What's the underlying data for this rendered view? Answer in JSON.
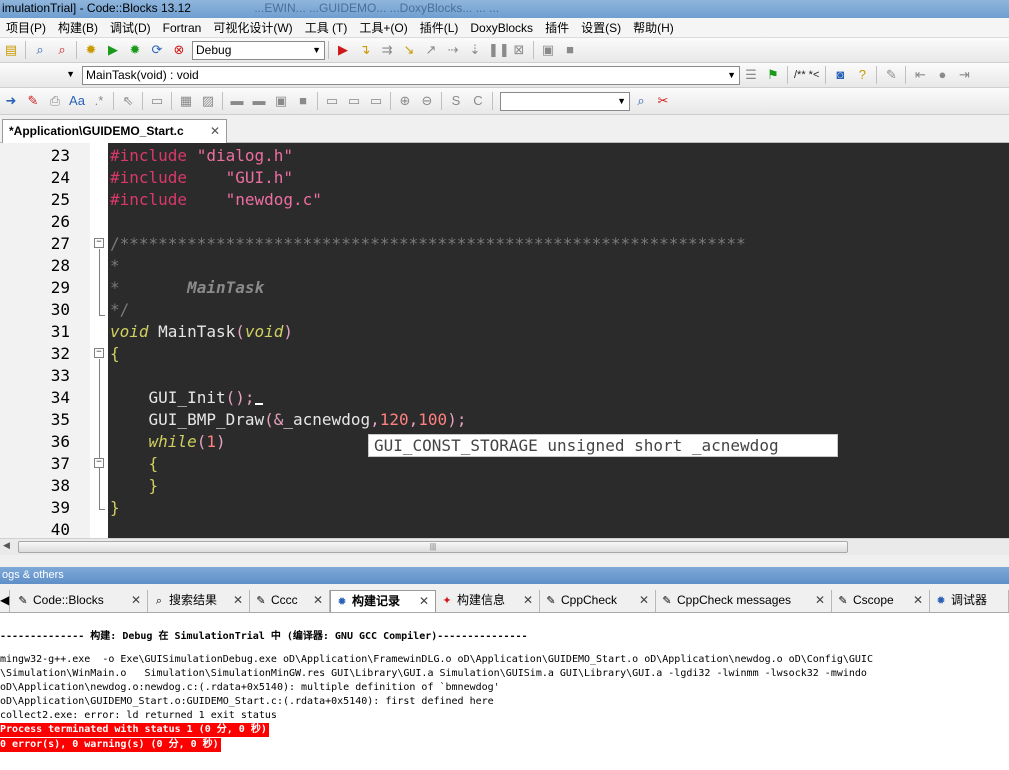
{
  "window": {
    "title": "imulationTrial] - Code::Blocks 13.12",
    "ghost_tabs": "...EWIN...  ...GUIDEMO...  ...DoxyBlocks...  ...   ..."
  },
  "menu": [
    "项目(P)",
    "构建(B)",
    "调试(D)",
    "Fortran",
    "可视化设计(W)",
    "工具 (T)",
    "工具+(O)",
    "插件(L)",
    "DoxyBlocks",
    "插件",
    "设置(S)",
    "帮助(H)"
  ],
  "toolbar": {
    "build_target": "Debug",
    "function_combo": "MainTask(void) : void",
    "doxy_text": "/** *<",
    "search_value": ""
  },
  "editor": {
    "tab_label": "*Application\\GUIDEMO_Start.c",
    "tab_close": "✕",
    "tooltip": "GUI_CONST_STORAGE unsigned short _acnewdog",
    "lines": {
      "l23": {
        "n": "23",
        "t1": "#include ",
        "t2": "\"dialog.h\""
      },
      "l24": {
        "n": "24",
        "t1": "#include    ",
        "t2": "\"GUI.h\""
      },
      "l25": {
        "n": "25",
        "t1": "#include    ",
        "t2": "\"newdog.c\""
      },
      "l26": {
        "n": "26"
      },
      "l27": {
        "n": "27",
        "t": "/*****************************************************************"
      },
      "l28": {
        "n": "28",
        "t": "*"
      },
      "l29": {
        "n": "29",
        "t1": "*       ",
        "t2": "MainTask"
      },
      "l30": {
        "n": "30",
        "t": "*/"
      },
      "l31": {
        "n": "31",
        "k1": "void",
        "id": " MainTask",
        "p1": "(",
        "k2": "void",
        "p2": ")"
      },
      "l32": {
        "n": "32",
        "t": "{"
      },
      "l33": {
        "n": "33"
      },
      "l34": {
        "n": "34",
        "id": "    GUI_Init",
        "p": "();"
      },
      "l35": {
        "n": "35",
        "id": "    GUI_BMP_Draw",
        "p1": "(&",
        "id2": "_acnewdog",
        "p2": ",",
        "num1": "120",
        "p3": ",",
        "num2": "100",
        "p4": ");"
      },
      "l36": {
        "n": "36",
        "k": "    while",
        "p1": "(",
        "num": "1",
        "p2": ")"
      },
      "l37": {
        "n": "37",
        "t": "    {"
      },
      "l38": {
        "n": "38",
        "t": "    }"
      },
      "l39": {
        "n": "39",
        "t": "}"
      },
      "l40": {
        "n": "40"
      }
    }
  },
  "logs": {
    "header": "ogs & others",
    "tabs": [
      "Code::Blocks",
      "搜索结果",
      "Cccc",
      "构建记录",
      "构建信息",
      "CppCheck",
      "CppCheck messages",
      "Cscope",
      "调试器"
    ],
    "lines": [
      "-------------- 构建: Debug 在 SimulationTrial 中 (编译器: GNU GCC Compiler)---------------",
      "mingw32-g++.exe  -o Exe\\GUISimulationDebug.exe oD\\Application\\FramewinDLG.o oD\\Application\\GUIDEMO_Start.o oD\\Application\\newdog.o oD\\Config\\GUIC",
      "\\Simulation\\WinMain.o   Simulation\\SimulationMinGW.res GUI\\Library\\GUI.a Simulation\\GUISim.a GUI\\Library\\GUI.a -lgdi32 -lwinmm -lwsock32 -mwindo",
      "oD\\Application\\newdog.o:newdog.c:(.rdata+0x5140): multiple definition of `bmnewdog'",
      "oD\\Application\\GUIDEMO_Start.o:GUIDEMO_Start.c:(.rdata+0x5140): first defined here",
      "collect2.exe: error: ld returned 1 exit status",
      "Process terminated with status 1 (0 分, 0 秒)",
      "0 error(s), 0 warning(s) (0 分, 0 秒)"
    ]
  }
}
